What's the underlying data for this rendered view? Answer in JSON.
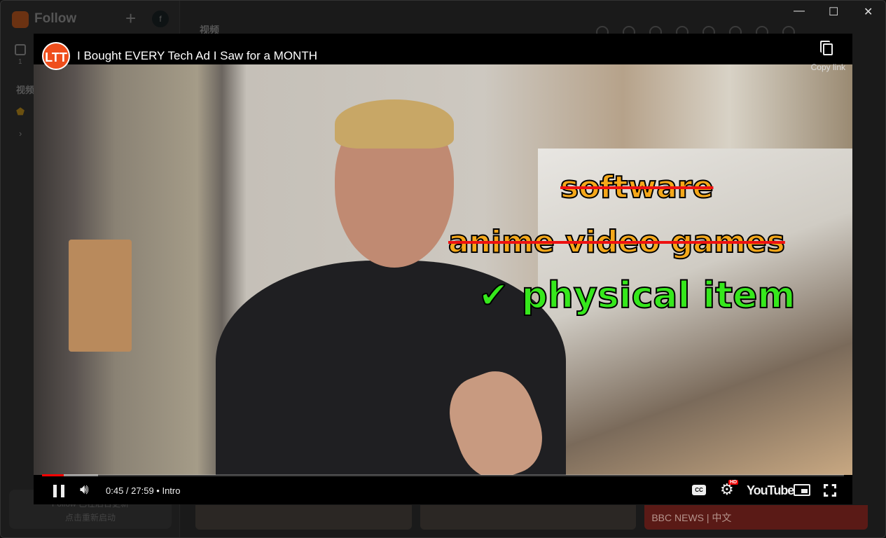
{
  "app": {
    "name": "Follow",
    "nav_count": "1",
    "section": "视频",
    "toast": {
      "line1": "Follow 已在后台更新",
      "line2": "点击重新启动"
    },
    "main_title": "视频",
    "thumb_label": "BBC NEWS | 中文"
  },
  "window": {
    "minimize": "—",
    "maximize": "☐",
    "close": "✕"
  },
  "player": {
    "channel_logo": "LTT",
    "title": "I Bought EVERY Tech Ad I Saw for a MONTH",
    "copy_link": "Copy link",
    "video_text": {
      "line1": "software",
      "line2": "anime video games",
      "line3": "✔ physical item"
    },
    "progress": {
      "played_fraction": 0.027,
      "buffered_fraction": 0.07
    },
    "time": "0:45 / 27:59",
    "chapter": "• Intro",
    "cc": "CC",
    "hd_badge": "HD",
    "youtube": "YouTube",
    "accent": "#ff0000"
  }
}
